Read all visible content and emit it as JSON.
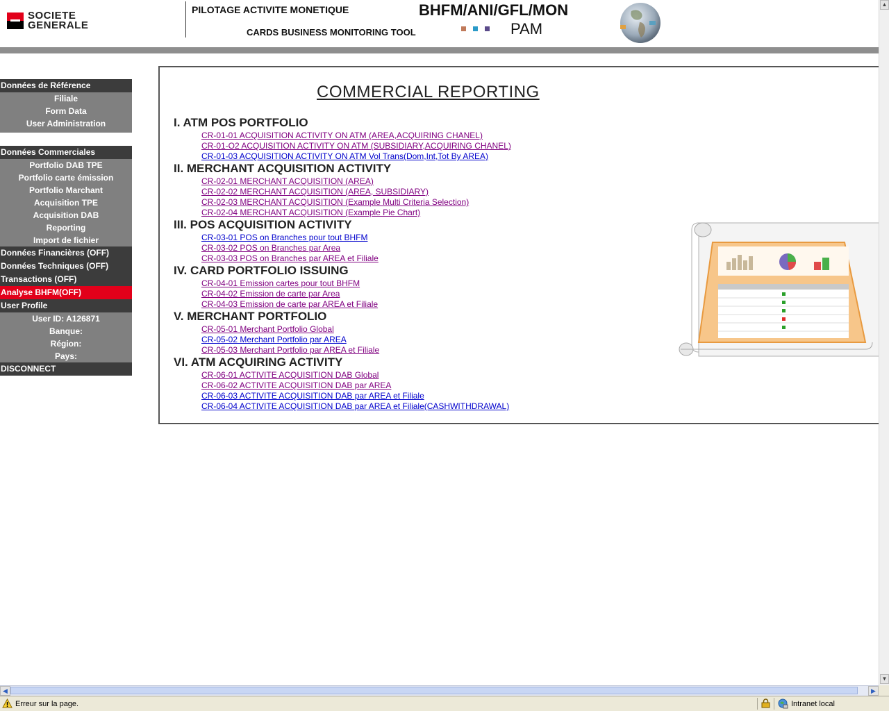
{
  "header": {
    "logo_line1": "SOCIETE",
    "logo_line2": "GENERALE",
    "subtitle1": "PILOTAGE ACTIVITE MONETIQUE",
    "subtitle2": "CARDS BUSINESS MONITORING TOOL",
    "code": "BHFM/ANI/GFL/MON",
    "pam": "PAM",
    "dot_colors": [
      "#c07a5a",
      "#2a9ac8",
      "#5a4a8a"
    ]
  },
  "menu": {
    "ref_head": "Données de Référence",
    "ref_items": [
      "Filiale",
      "Form Data",
      "User Administration"
    ],
    "com_head": "Données Commerciales",
    "com_items": [
      "Portfolio DAB TPE",
      "Portfolio carte émission",
      "Portfolio Marchant",
      "Acquisition TPE",
      "Acquisition DAB",
      "Reporting",
      "Import de fichier"
    ],
    "fin": "Données Financières (OFF)",
    "tech": "Données Techniques (OFF)",
    "trans": "Transactions (OFF)",
    "analyse": "Analyse BHFM(OFF)",
    "profile_head": "User Profile",
    "user_id": "User ID: A126871",
    "banque": "Banque:",
    "region": "Région:",
    "pays": "Pays:",
    "disconnect": "DISCONNECT"
  },
  "report": {
    "title": "COMMERCIAL REPORTING",
    "sections": [
      {
        "title": "I. ATM POS PORTFOLIO",
        "links": [
          "CR-01-01  ACQUISITION ACTIVITY ON ATM (AREA,ACQUIRING CHANEL)",
          "CR-01-O2   ACQUISITION ACTIVITY ON ATM (SUBSIDIARY,ACQUIRING CHANEL)",
          "CR-01-03  ACQUISITION ACTIVITY ON ATM  Vol  Trans(Dom,Int,Tot By AREA)"
        ]
      },
      {
        "title": "II. MERCHANT ACQUISITION ACTIVITY",
        "links": [
          "CR-02-01  MERCHANT ACQUISITION (AREA)",
          "CR-02-02  MERCHANT ACQUISITION (AREA, SUBSIDIARY)",
          "CR-02-03  MERCHANT ACQUISITION (Example Multi Criteria Selection)",
          "CR-02-04  MERCHANT ACQUISITION (Example Pie Chart)"
        ]
      },
      {
        "title": "III. POS ACQUISITION ACTIVITY",
        "links": [
          "CR-03-01  POS on Branches pour tout BHFM",
          "CR-03-02  POS on Branches par Area",
          "CR-03-03  POS on Branches par AREA et Filiale"
        ]
      },
      {
        "title": "IV. CARD PORTFOLIO ISSUING",
        "links": [
          "CR-04-01  Emission cartes pour tout BHFM",
          "CR-04-02  Emission de carte par Area",
          "CR-04-03  Emission de carte par AREA et Filiale"
        ]
      },
      {
        "title": "V. MERCHANT PORTFOLIO",
        "links": [
          "CR-05-01  Merchant Portfolio Global",
          "CR-05-02  Merchant Portfolio par AREA",
          "CR-05-03  Merchant Portfolio par AREA et Filiale"
        ]
      },
      {
        "title": "VI. ATM ACQUIRING ACTIVITY",
        "links": [
          "CR-06-01  ACTIVITE ACQUISITION DAB Global",
          "CR-06-02  ACTIVITE ACQUISITION DAB par AREA",
          "CR-06-03  ACTIVITE ACQUISITION DAB par AREA et Filiale",
          "CR-06-04  ACTIVITE ACQUISITION DAB par AREA et Filiale(CASHWITHDRAWAL)"
        ]
      }
    ]
  },
  "status": {
    "message": "Erreur sur la page.",
    "zone": "Intranet local"
  }
}
